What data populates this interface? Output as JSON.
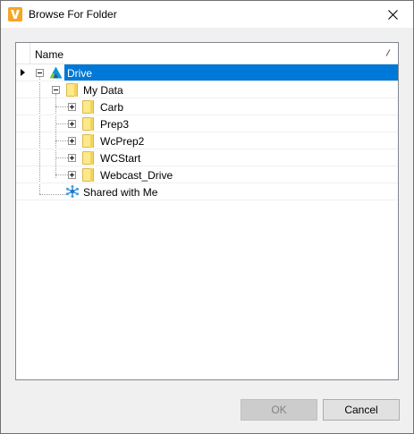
{
  "window": {
    "title": "Browse For Folder"
  },
  "tree": {
    "column_header": "Name",
    "items": [
      {
        "label": "Drive",
        "icon": "autodesk-drive-icon",
        "selected": true
      },
      {
        "label": "My Data",
        "icon": "folder-icon"
      },
      {
        "label": "Carb",
        "icon": "folder-icon"
      },
      {
        "label": "Prep3",
        "icon": "folder-icon"
      },
      {
        "label": "WcPrep2",
        "icon": "folder-icon"
      },
      {
        "label": "WCStart",
        "icon": "folder-icon"
      },
      {
        "label": "Webcast_Drive",
        "icon": "folder-icon"
      },
      {
        "label": "Shared with Me",
        "icon": "shared-network-icon"
      }
    ]
  },
  "buttons": {
    "ok_label": "OK",
    "cancel_label": "Cancel"
  },
  "colors": {
    "selection": "#0078d7",
    "folder": "#fbe98a",
    "app_icon": "#f5a623"
  }
}
